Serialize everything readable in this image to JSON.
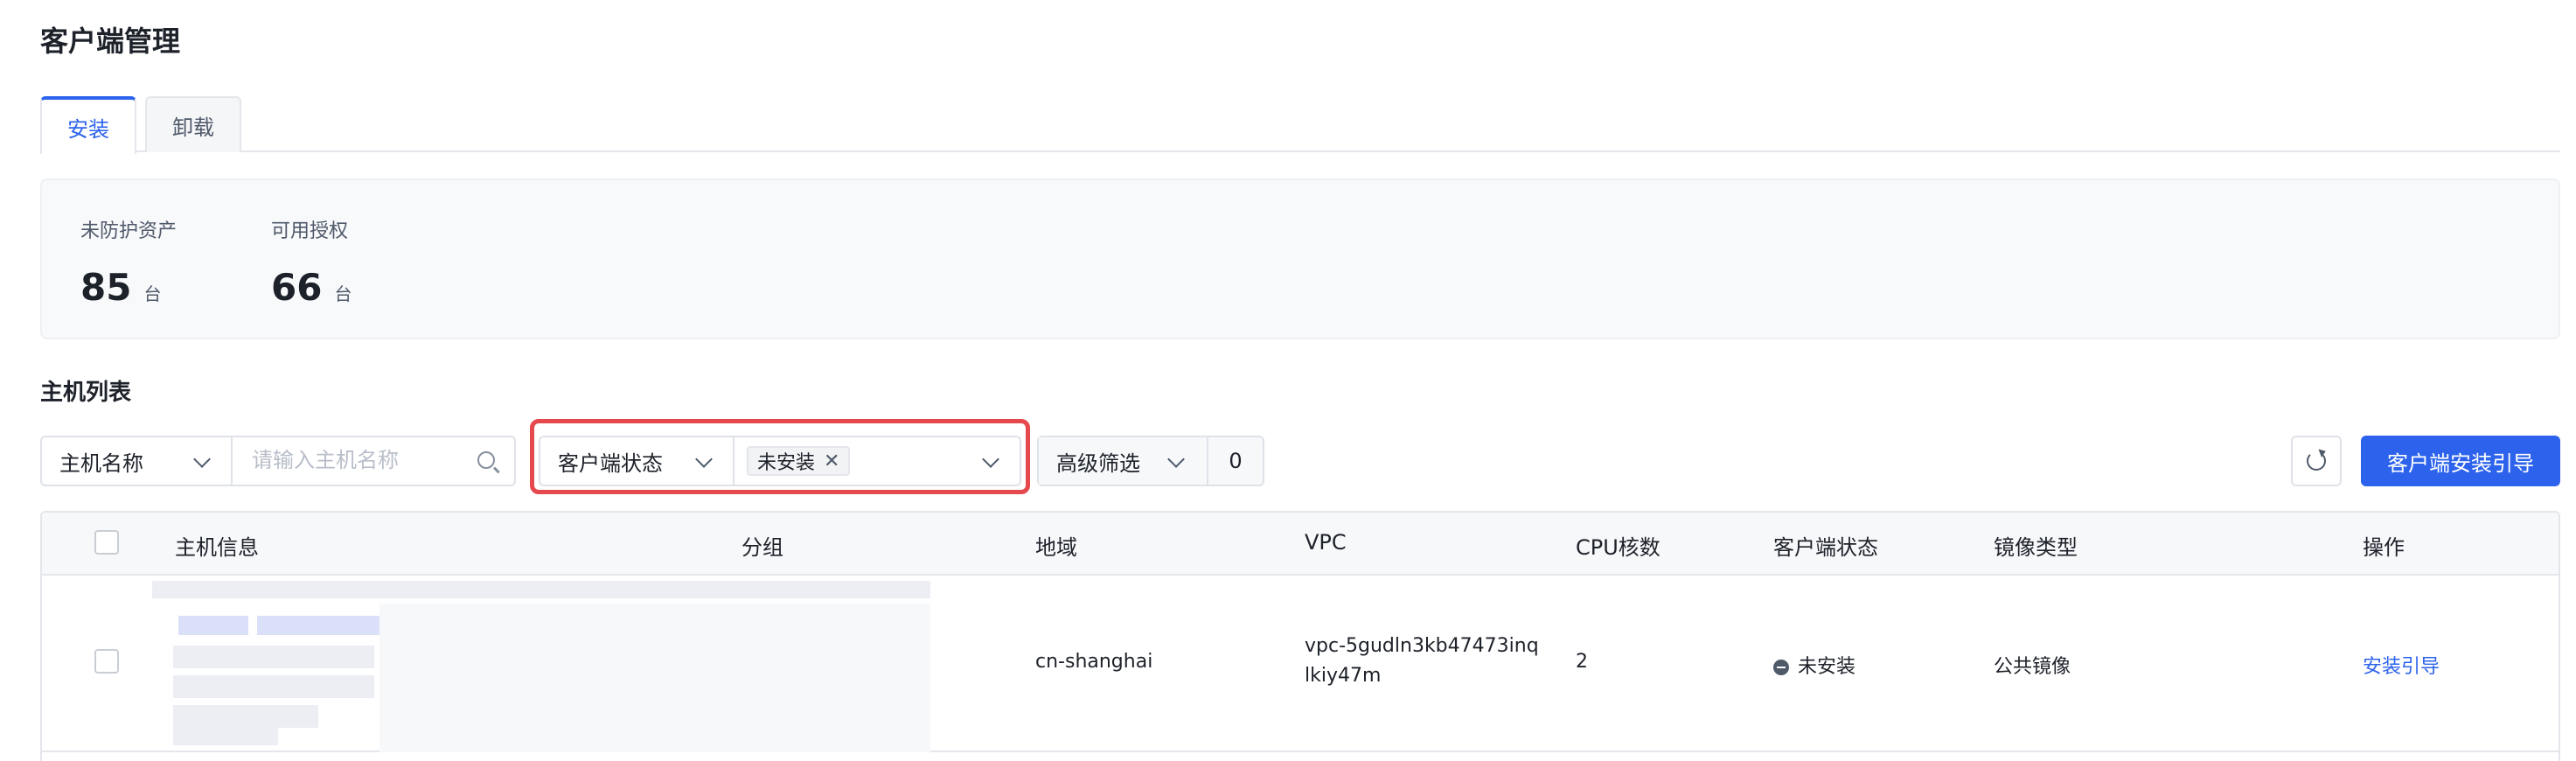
{
  "page": {
    "title": "客户端管理"
  },
  "tabs": [
    {
      "label": "安装",
      "active": true
    },
    {
      "label": "卸载",
      "active": false
    }
  ],
  "stats": [
    {
      "label": "未防护资产",
      "value": "85",
      "unit": "台"
    },
    {
      "label": "可用授权",
      "value": "66",
      "unit": "台"
    }
  ],
  "section": {
    "title": "主机列表"
  },
  "filters": {
    "field_select": "主机名称",
    "search_placeholder": "请输入主机名称",
    "status_select": "客户端状态",
    "status_tag": "未安装",
    "status_tag_close": "✕",
    "advanced_label": "高级筛选",
    "advanced_count": "0"
  },
  "actions": {
    "install_guide_button": "客户端安装引导"
  },
  "table": {
    "columns": [
      "主机信息",
      "分组",
      "地域",
      "VPC",
      "CPU核数",
      "客户端状态",
      "镜像类型",
      "操作"
    ],
    "rows": [
      {
        "region": "cn-shanghai",
        "vpc_line1": "vpc-5gudln3kb47473inq",
        "vpc_line2": "lkiy47m",
        "cpu": "2",
        "status": "未安装",
        "image_type": "公共镜像",
        "action": "安装引导"
      }
    ]
  },
  "colors": {
    "primary": "#2d63ec",
    "highlight": "#e5484d"
  }
}
